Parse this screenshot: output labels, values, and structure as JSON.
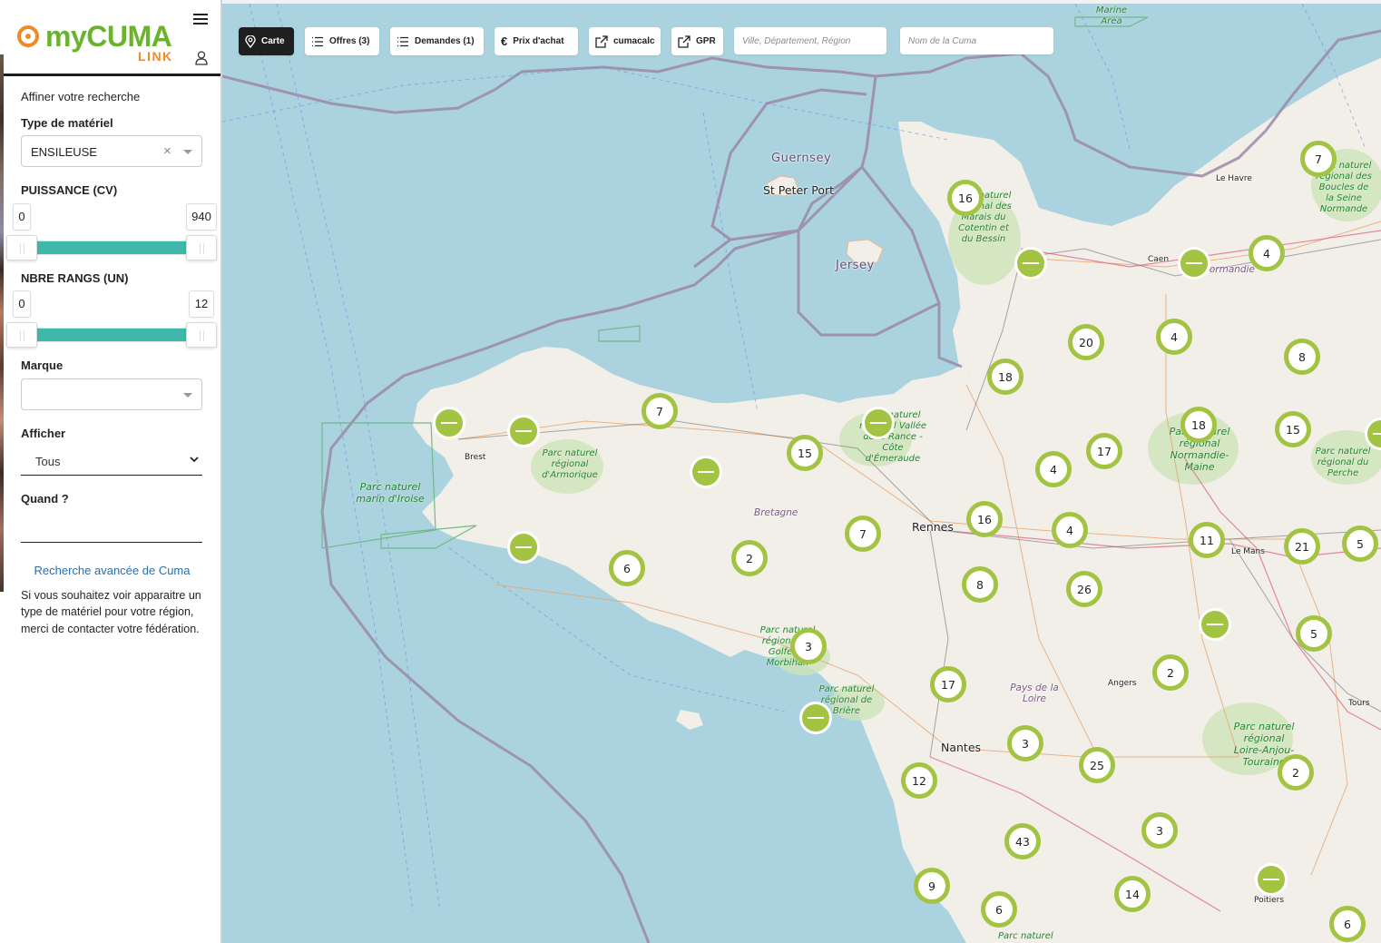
{
  "app": {
    "logo_word": "myCUMA",
    "logo_sub": "LINK",
    "brand_green": "#6ab42d",
    "brand_orange": "#f08a24",
    "accent_teal": "#3fb8ab",
    "marker_green": "#a3c443"
  },
  "sidebar": {
    "refine_title": "Affiner votre recherche",
    "material_type": {
      "label": "Type de matériel",
      "value": "ENSILEUSE",
      "clear_icon": "×"
    },
    "power": {
      "label": "PUISSANCE (CV)",
      "min": "0",
      "max": "940",
      "range_low": 0,
      "range_high": 940
    },
    "rows": {
      "label": "NBRE RANGS (UN)",
      "min": "0",
      "max": "12",
      "range_low": 0,
      "range_high": 12
    },
    "brand": {
      "label": "Marque",
      "value": ""
    },
    "display": {
      "label": "Afficher",
      "value": "Tous"
    },
    "when": {
      "label": "Quand ?",
      "value": ""
    },
    "advanced_link": "Recherche avancée de Cuma",
    "note": "Si vous souhaitez voir apparaitre un type de matériel pour votre région, merci de contacter votre fédération."
  },
  "toolbar": {
    "map_btn": "Carte",
    "offers_btn": "Offres (3)",
    "requests_btn": "Demandes (1)",
    "price_btn": "Prix d'achat",
    "price_icon": "€",
    "cumacalc_btn": "cumacalc",
    "gpr_btn": "GPR",
    "location_placeholder": "Ville, Département, Région",
    "cuma_name_placeholder": "Nom de la Cuma"
  },
  "map": {
    "places": {
      "guernsey": "Guernsey",
      "st_peter_port": "St Peter Port",
      "jersey": "Jersey",
      "le_havre": "Le Havre",
      "caen": "Caen",
      "normandie": "Normandie",
      "brest": "Brest",
      "bretagne": "Bretagne",
      "rennes": "Rennes",
      "le_mans": "Le Mans",
      "angers": "Angers",
      "tours": "Tours",
      "nantes": "Nantes",
      "pays_de_la_loire": "Pays de la Loire",
      "poitiers": "Poitiers"
    },
    "parks": {
      "marine_area": "Marine Area",
      "marais_cotentin": "Parc naturel régional des Marais du Cotentin et du Bessin",
      "boucles_seine": "Parc naturel régional des Boucles de la Seine Normande",
      "iroise": "Parc naturel marin d'Iroise",
      "armorique": "Parc naturel régional d'Armorique",
      "rance": "Parc naturel régional Vallée de la Rance - Côte d'Émeraude",
      "normandie_maine": "Parc naturel régional Normandie-Maine",
      "perche": "Parc naturel régional du Perche",
      "golfe_morbihan": "Parc naturel régional du Golfe du Morbihan",
      "briere": "Parc naturel régional de Brière",
      "loire_anjou": "Parc naturel régional Loire-Anjou-Touraine",
      "bottom": "Parc naturel"
    },
    "clusters": [
      "16",
      "7",
      "4",
      "20",
      "4",
      "8",
      "18",
      "7",
      "15",
      "18",
      "17",
      "4",
      "15",
      "16",
      "7",
      "4",
      "11",
      "21",
      "5",
      "6",
      "2",
      "8",
      "26",
      "5",
      "3",
      "17",
      "2",
      "3",
      "25",
      "12",
      "2",
      "3",
      "43",
      "9",
      "14",
      "6",
      "6"
    ],
    "single_markers_count": 11
  }
}
